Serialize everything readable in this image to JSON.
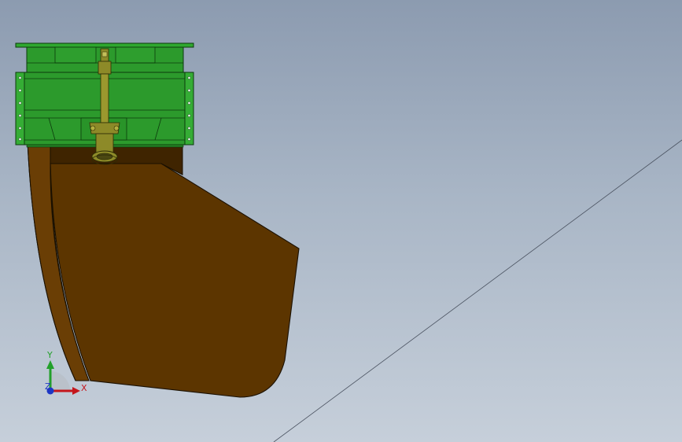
{
  "viewport": {
    "background_top": "#8c9bb0",
    "background_bottom": "#c6cfda"
  },
  "model": {
    "chute_color": "#5c3500",
    "flange_color": "#2c9a2c",
    "shaft_color": "#8d8a28"
  },
  "triad": {
    "x_label": "X",
    "y_label": "Y",
    "z_label": "Z",
    "x_color": "#c4161c",
    "y_color": "#22a02a",
    "z_color": "#1d36c4"
  }
}
